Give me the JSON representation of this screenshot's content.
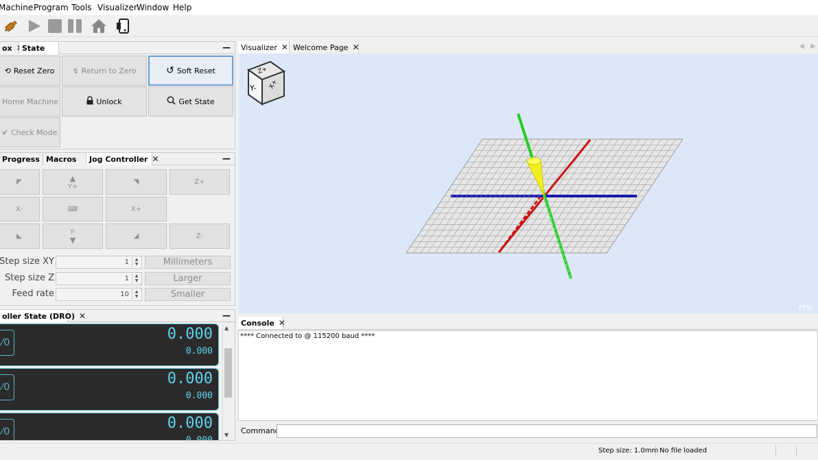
{
  "menu": [
    "Machine",
    "Program",
    "Tools",
    "Visualizer",
    "Window",
    "Help"
  ],
  "toolbar": {
    "icons": [
      "connect-icon",
      "play-icon",
      "stop-icon",
      "pause-icon",
      "home-icon",
      "device-icon"
    ]
  },
  "state_panel": {
    "tabs": [
      "ox",
      "State"
    ],
    "buttons": {
      "reset_zero": "Reset Zero",
      "return_to_zero": "Return to Zero",
      "soft_reset": "Soft Reset",
      "home_machine": "Home Machine",
      "unlock": "Unlock",
      "get_state": "Get State",
      "check_mode": "Check Mode"
    }
  },
  "jog_panel": {
    "tabs": [
      "Progress",
      "Macros",
      "Jog Controller"
    ],
    "labels": {
      "y_plus": "Y+",
      "y_minus": "Y-",
      "x_minus": "X-",
      "x_plus": "X+",
      "z_plus": "Z+",
      "z_minus": "Z-"
    },
    "step_xy": {
      "label": "Step size XY",
      "value": "1"
    },
    "step_z": {
      "label": "Step size Z",
      "value": "1"
    },
    "feed_rate": {
      "label": "Feed rate",
      "value": "10"
    },
    "units_button": "Millimeters",
    "larger_button": "Larger",
    "smaller_button": "Smaller"
  },
  "dro_panel": {
    "title": "oller State (DRO)",
    "rows": [
      {
        "axis": "0",
        "work": "0.000",
        "machine": "0.000"
      },
      {
        "axis": "0",
        "work": "0.000",
        "machine": "0.000"
      },
      {
        "axis": "0",
        "work": "0.000",
        "machine": "0.000"
      }
    ]
  },
  "viz_panel": {
    "tabs": [
      "Visualizer",
      "Welcome Page"
    ],
    "cube_labels": {
      "top": "Z+",
      "front": "Y-",
      "side": "X+"
    },
    "fps_label": "FPS:"
  },
  "console": {
    "tab": "Console",
    "text": "**** Connected to  @ 115200 baud ****",
    "command_label": "Command:",
    "command_value": ""
  },
  "status": {
    "step_size": "Step size: 1.0mm",
    "file": "No file loaded"
  },
  "colors": {
    "grid_line": "#9a9a9a",
    "grid_fill": "#e6e6e6",
    "x_axis": "#cc1111",
    "y_axis": "#22cc22",
    "z_axis": "#1a1aaa",
    "tool": "#f0f020",
    "dro_text": "#5fd6f0"
  }
}
